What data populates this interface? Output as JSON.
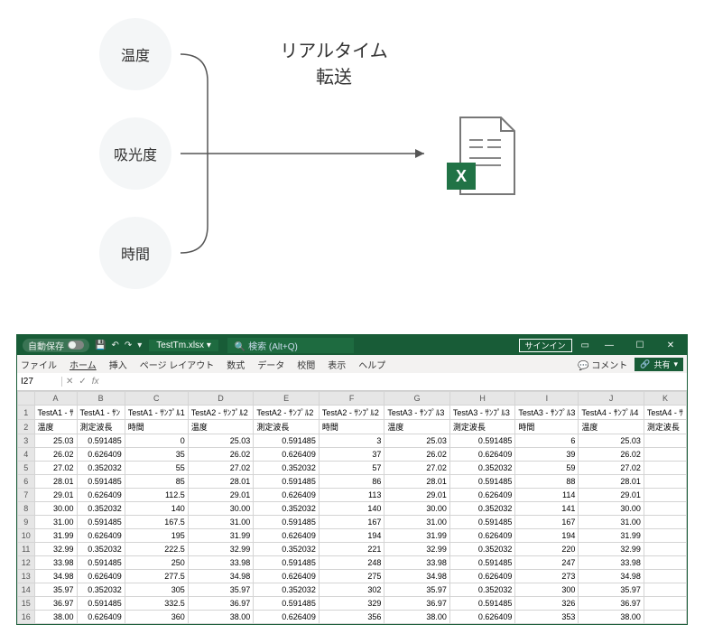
{
  "diagram": {
    "circle1": "温度",
    "circle2": "吸光度",
    "circle3": "時間",
    "label_line1": "リアルタイム",
    "label_line2": "転送"
  },
  "titlebar": {
    "autosave": "自動保存",
    "off": "オフ",
    "filename": "TestTm.xlsx",
    "search_placeholder": "検索 (Alt+Q)",
    "signin": "サインイン"
  },
  "ribbon": {
    "file": "ファイル",
    "home": "ホーム",
    "insert": "挿入",
    "layout": "ページ レイアウト",
    "formulas": "数式",
    "data": "データ",
    "review": "校閲",
    "view": "表示",
    "help": "ヘルプ",
    "comment": "コメント",
    "share": "共有"
  },
  "formula_bar": {
    "cell_ref": "I27",
    "fx": "fx"
  },
  "columns": [
    "A",
    "B",
    "C",
    "D",
    "E",
    "F",
    "G",
    "H",
    "I",
    "J",
    "K"
  ],
  "header_row_1": [
    "TestA1 - ｻ",
    "TestA1 - ｻﾝ",
    "TestA1 - ｻﾝﾌﾟﾙ1",
    "TestA2 - ｻﾝﾌﾟﾙ2",
    "TestA2 - ｻﾝﾌﾟﾙ2",
    "TestA2 - ｻﾝﾌﾟﾙ2",
    "TestA3 - ｻﾝﾌﾟﾙ3",
    "TestA3 - ｻﾝﾌﾟﾙ3",
    "TestA3 - ｻﾝﾌﾟﾙ3",
    "TestA4 - ｻﾝﾌﾟﾙ4",
    "TestA4 - ｻ"
  ],
  "header_row_2": [
    "温度",
    "測定波長",
    "時間",
    "温度",
    "測定波長",
    "時間",
    "温度",
    "測定波長",
    "時間",
    "温度",
    "測定波長"
  ],
  "chart_data": {
    "type": "table",
    "rows": [
      {
        "r": 3,
        "v": [
          "25.03",
          "0.591485",
          "0",
          "25.03",
          "0.591485",
          "3",
          "25.03",
          "0.591485",
          "6",
          "25.03",
          ""
        ]
      },
      {
        "r": 4,
        "v": [
          "26.02",
          "0.626409",
          "35",
          "26.02",
          "0.626409",
          "37",
          "26.02",
          "0.626409",
          "39",
          "26.02",
          ""
        ]
      },
      {
        "r": 5,
        "v": [
          "27.02",
          "0.352032",
          "55",
          "27.02",
          "0.352032",
          "57",
          "27.02",
          "0.352032",
          "59",
          "27.02",
          ""
        ]
      },
      {
        "r": 6,
        "v": [
          "28.01",
          "0.591485",
          "85",
          "28.01",
          "0.591485",
          "86",
          "28.01",
          "0.591485",
          "88",
          "28.01",
          ""
        ]
      },
      {
        "r": 7,
        "v": [
          "29.01",
          "0.626409",
          "112.5",
          "29.01",
          "0.626409",
          "113",
          "29.01",
          "0.626409",
          "114",
          "29.01",
          ""
        ]
      },
      {
        "r": 8,
        "v": [
          "30.00",
          "0.352032",
          "140",
          "30.00",
          "0.352032",
          "140",
          "30.00",
          "0.352032",
          "141",
          "30.00",
          ""
        ]
      },
      {
        "r": 9,
        "v": [
          "31.00",
          "0.591485",
          "167.5",
          "31.00",
          "0.591485",
          "167",
          "31.00",
          "0.591485",
          "167",
          "31.00",
          ""
        ]
      },
      {
        "r": 10,
        "v": [
          "31.99",
          "0.626409",
          "195",
          "31.99",
          "0.626409",
          "194",
          "31.99",
          "0.626409",
          "194",
          "31.99",
          ""
        ]
      },
      {
        "r": 11,
        "v": [
          "32.99",
          "0.352032",
          "222.5",
          "32.99",
          "0.352032",
          "221",
          "32.99",
          "0.352032",
          "220",
          "32.99",
          ""
        ]
      },
      {
        "r": 12,
        "v": [
          "33.98",
          "0.591485",
          "250",
          "33.98",
          "0.591485",
          "248",
          "33.98",
          "0.591485",
          "247",
          "33.98",
          ""
        ]
      },
      {
        "r": 13,
        "v": [
          "34.98",
          "0.626409",
          "277.5",
          "34.98",
          "0.626409",
          "275",
          "34.98",
          "0.626409",
          "273",
          "34.98",
          ""
        ]
      },
      {
        "r": 14,
        "v": [
          "35.97",
          "0.352032",
          "305",
          "35.97",
          "0.352032",
          "302",
          "35.97",
          "0.352032",
          "300",
          "35.97",
          ""
        ]
      },
      {
        "r": 15,
        "v": [
          "36.97",
          "0.591485",
          "332.5",
          "36.97",
          "0.591485",
          "329",
          "36.97",
          "0.591485",
          "326",
          "36.97",
          ""
        ]
      },
      {
        "r": 16,
        "v": [
          "38.00",
          "0.626409",
          "360",
          "38.00",
          "0.626409",
          "356",
          "38.00",
          "0.626409",
          "353",
          "38.00",
          ""
        ]
      }
    ]
  }
}
